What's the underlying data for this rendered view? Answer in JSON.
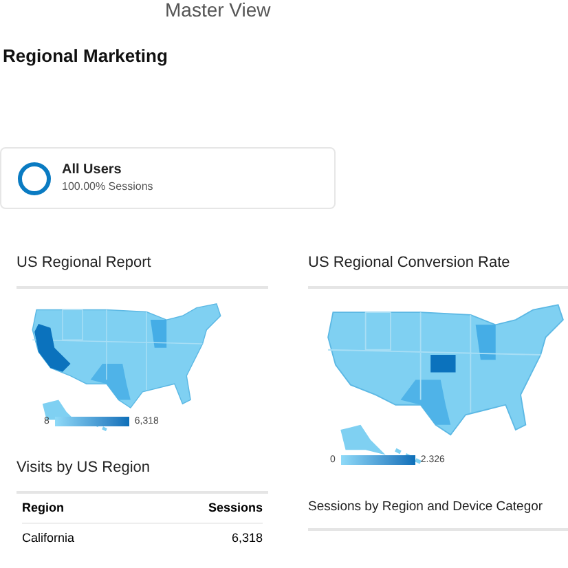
{
  "view": {
    "title": "Master View"
  },
  "page_title": "Regional Marketing",
  "segment": {
    "name": "All Users",
    "detail": "100.00% Sessions"
  },
  "left": [
    {
      "kind": "map",
      "title": "US Regional Report",
      "legend_min": "8",
      "legend_max": "6,318"
    },
    {
      "kind": "table",
      "title": "Visits by US Region",
      "columns": [
        "Region",
        "Sessions"
      ],
      "rows": [
        [
          "California",
          "6,318"
        ]
      ]
    }
  ],
  "right": [
    {
      "kind": "map",
      "title": "US Regional Conversion Rate",
      "legend_min": "0",
      "legend_max": "2.326"
    },
    {
      "kind": "title_only",
      "title": "Sessions by Region and Device Categor"
    }
  ]
}
